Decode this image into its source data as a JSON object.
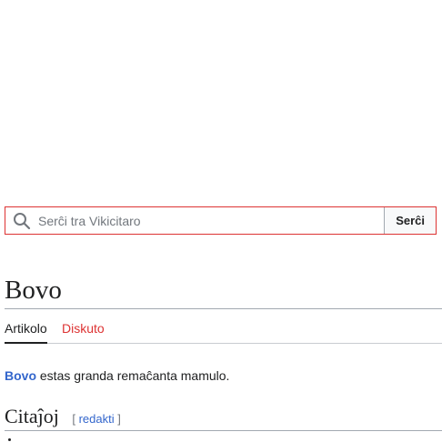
{
  "search": {
    "placeholder": "Serĉi tra Vikicitaro",
    "value": "",
    "button_label": "Serĉi",
    "icon": "search-icon",
    "border_color": "#dd3333"
  },
  "page": {
    "title": "Bovo",
    "tabs": [
      {
        "label": "Artikolo",
        "active": true
      },
      {
        "label": "Diskuto",
        "active": false,
        "color": "#dd3333"
      }
    ],
    "lead": {
      "link_text": "Bovo",
      "text": " estas granda remaĉanta mamulo."
    },
    "section": {
      "heading": "Citaĵoj",
      "edit_open": "[",
      "edit_label": "redakti",
      "edit_close": "]"
    }
  },
  "colors": {
    "link": "#3366cc",
    "new_link": "#dd3333",
    "text": "#202122"
  }
}
